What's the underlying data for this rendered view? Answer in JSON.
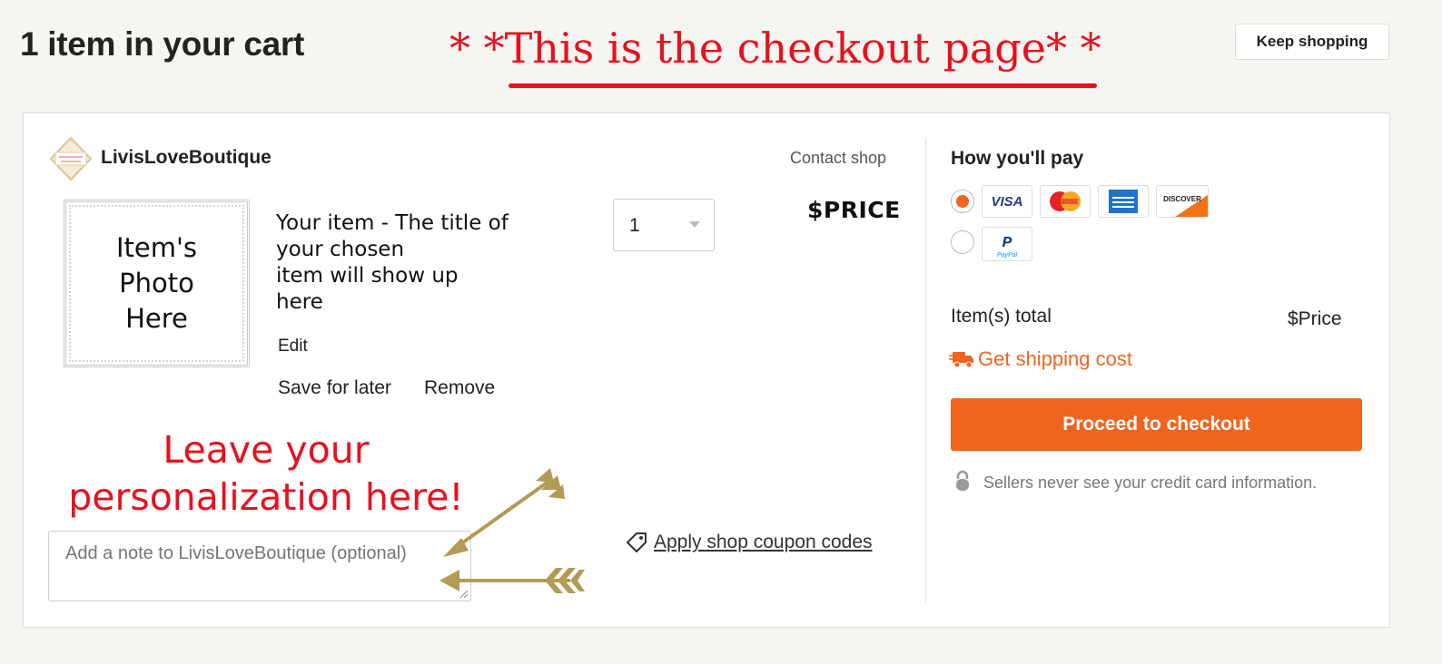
{
  "header": {
    "cart_title": "1 item in your cart",
    "annotation_prefix": "* *",
    "annotation_text": "This is the checkout page",
    "annotation_suffix": "* *",
    "keep_shopping_label": "Keep shopping"
  },
  "shop": {
    "name": "LivisLoveBoutique",
    "contact_label": "Contact shop"
  },
  "item": {
    "photo_placeholder_line1": "Item's",
    "photo_placeholder_line2": "Photo",
    "photo_placeholder_line3": "Here",
    "title_line1": "Your item - The title of",
    "title_line2": "your chosen",
    "title_line3": "item will show up",
    "title_line4": "here",
    "edit_label": "Edit",
    "save_for_later_label": "Save for later",
    "remove_label": "Remove",
    "quantity": "1",
    "price": "$PRICE"
  },
  "personalization": {
    "annotation_line1": "Leave your",
    "annotation_line2": "personalization here!",
    "note_placeholder": "Add a note to LivisLoveBoutique (optional)"
  },
  "coupon": {
    "label": "Apply shop coupon codes"
  },
  "payment": {
    "title": "How you'll pay",
    "selected_method": "card",
    "card_brands": [
      "VISA",
      "MasterCard",
      "American Express",
      "DISCOVER"
    ],
    "paypal_label": "PayPal",
    "items_total_label": "Item(s) total",
    "items_total_value": "$Price",
    "shipping_label": "Get shipping cost",
    "checkout_label": "Proceed to checkout",
    "secure_note": "Sellers never see your credit card information."
  },
  "colors": {
    "accent": "#f1641e",
    "annotation_red": "#e8101e",
    "arrow_gold": "#b39a55",
    "background": "#f5f5f1"
  }
}
